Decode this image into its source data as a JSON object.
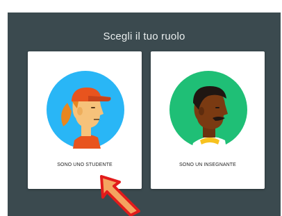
{
  "dialog": {
    "title": "Scegli il tuo ruolo"
  },
  "roles": [
    {
      "label": "SONO UNO STUDENTE",
      "avatar_icon": "student-avatar-icon",
      "avatar_bg": "#29b6f6"
    },
    {
      "label": "SONO UN INSEGNANTE",
      "avatar_icon": "teacher-avatar-icon",
      "avatar_bg": "#1fbf76"
    }
  ],
  "colors": {
    "dialog_bg": "#3b4a4f",
    "card_bg": "#ffffff",
    "arrow_fill": "#f4a460",
    "arrow_outline": "#e21b1b"
  }
}
